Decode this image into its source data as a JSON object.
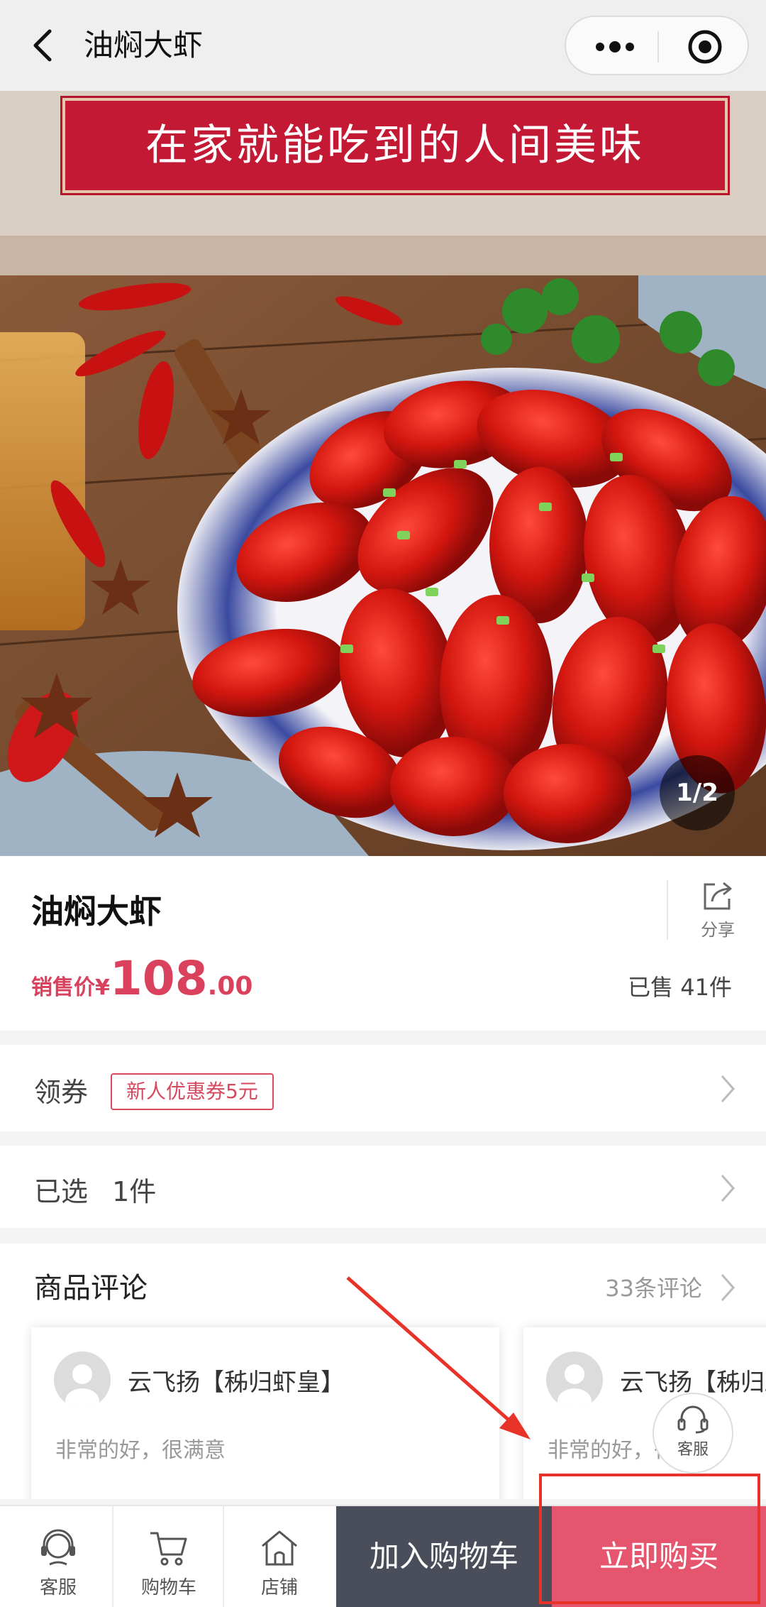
{
  "navbar": {
    "title": "油焖大虾",
    "back_icon": "chevron-left-icon",
    "more_icon": "more-dots-icon",
    "target_icon": "record-target-icon"
  },
  "hero": {
    "banner_text": "在家就能吃到的人间美味",
    "counter": "1/2"
  },
  "product": {
    "name": "油焖大虾",
    "share_label": "分享",
    "price_label": "销售价",
    "currency": "¥",
    "price_int": "108",
    "price_dec": ".00",
    "sold": "已售 41件"
  },
  "coupon_row": {
    "label": "领券",
    "coupon": "新人优惠券5元"
  },
  "selected_row": {
    "label": "已选",
    "value": "1件"
  },
  "reviews": {
    "title": "商品评论",
    "count": "33条评论",
    "items": [
      {
        "user": "云飞扬【秭归虾皇】",
        "text": "非常的好，很满意"
      },
      {
        "user": "云飞扬【秭归虾皇】",
        "text": "非常的好，很满意"
      }
    ]
  },
  "float_service": {
    "label": "客服"
  },
  "bottombar": {
    "tabs": [
      {
        "label": "客服",
        "icon": "customer-service-icon"
      },
      {
        "label": "购物车",
        "icon": "cart-icon"
      },
      {
        "label": "店铺",
        "icon": "store-icon"
      }
    ],
    "add_to_cart": "加入购物车",
    "buy_now": "立即购买"
  },
  "colors": {
    "accent": "#d9415d",
    "cart_button": "#4a4e5a",
    "buy_button": "#e5566e",
    "annotation": "#e8332a"
  }
}
